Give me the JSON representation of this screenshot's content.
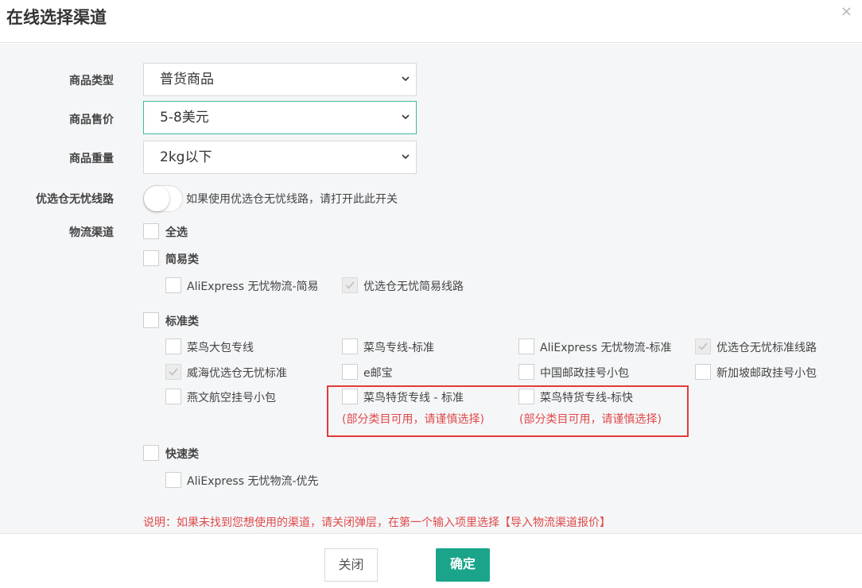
{
  "dialog": {
    "title": "在线选择渠道",
    "close_icon": "×"
  },
  "form": {
    "goods_type": {
      "label": "商品类型",
      "value": "普货商品"
    },
    "goods_price": {
      "label": "商品售价",
      "value": "5-8美元"
    },
    "goods_weight": {
      "label": "商品重量",
      "value": "2kg以下"
    },
    "preferred_warehouse": {
      "label": "优选仓无忧线路",
      "hint": "如果使用优选仓无忧线路，请打开此此开关",
      "enabled": false
    },
    "logistics": {
      "label": "物流渠道",
      "select_all": "全选"
    }
  },
  "groups": {
    "simple": {
      "label": "简易类",
      "items": [
        {
          "label": "AliExpress 无忧物流-简易",
          "checked": false
        },
        {
          "label": "优选仓无忧简易线路",
          "checked": true
        }
      ]
    },
    "standard": {
      "label": "标准类",
      "items": [
        {
          "label": "菜鸟大包专线",
          "checked": false
        },
        {
          "label": "菜鸟专线-标准",
          "checked": false
        },
        {
          "label": "AliExpress 无忧物流-标准",
          "checked": false
        },
        {
          "label": "优选仓无忧标准线路",
          "checked": true
        },
        {
          "label": "威海优选仓无忧标准",
          "checked": true
        },
        {
          "label": "e邮宝",
          "checked": false
        },
        {
          "label": "中国邮政挂号小包",
          "checked": false
        },
        {
          "label": "新加坡邮政挂号小包",
          "checked": false
        },
        {
          "label": "燕文航空挂号小包",
          "checked": false
        },
        {
          "label": "菜鸟特货专线 - 标准",
          "checked": false,
          "warning": "(部分类目可用，请谨慎选择)"
        },
        {
          "label": "菜鸟特货专线-标快",
          "checked": false,
          "warning": "(部分类目可用，请谨慎选择)"
        }
      ]
    },
    "express": {
      "label": "快速类",
      "items": [
        {
          "label": "AliExpress 无忧物流-优先",
          "checked": false
        }
      ]
    }
  },
  "note": "说明：如果未找到您想使用的渠道，请关闭弹层，在第一个输入项里选择【导入物流渠道报价】",
  "buttons": {
    "close": "关闭",
    "confirm": "确定"
  },
  "colors": {
    "primary": "#1aa58b",
    "warning": "#e04a4a",
    "focus_border": "#3fb99e"
  }
}
